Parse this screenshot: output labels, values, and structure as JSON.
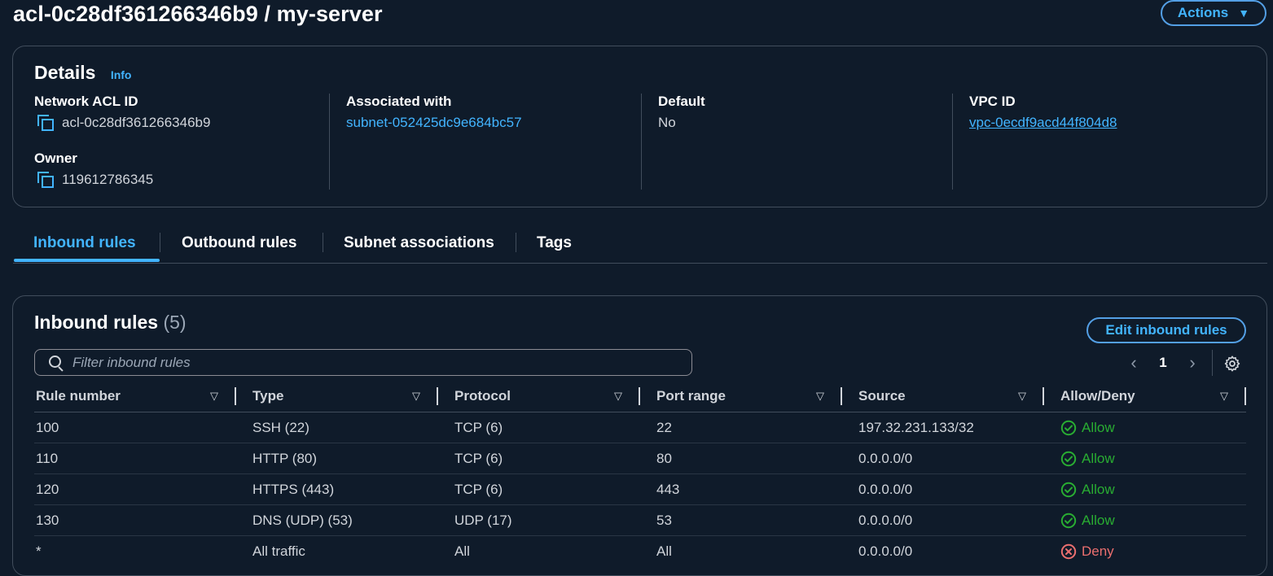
{
  "page": {
    "title": "acl-0c28df361266346b9 / my-server",
    "actions_label": "Actions"
  },
  "details": {
    "heading": "Details",
    "info_label": "Info",
    "network_acl_id_label": "Network ACL ID",
    "network_acl_id_value": "acl-0c28df361266346b9",
    "owner_label": "Owner",
    "owner_value": "119612786345",
    "associated_with_label": "Associated with",
    "associated_with_value": "subnet-052425dc9e684bc57",
    "default_label": "Default",
    "default_value": "No",
    "vpc_id_label": "VPC ID",
    "vpc_id_value": "vpc-0ecdf9acd44f804d8"
  },
  "tabs": [
    {
      "label": "Inbound rules",
      "active": true
    },
    {
      "label": "Outbound rules",
      "active": false
    },
    {
      "label": "Subnet associations",
      "active": false
    },
    {
      "label": "Tags",
      "active": false
    }
  ],
  "inbound": {
    "heading": "Inbound rules",
    "count": "(5)",
    "edit_button": "Edit inbound rules",
    "filter_placeholder": "Filter inbound rules",
    "page_number": "1",
    "columns": [
      "Rule number",
      "Type",
      "Protocol",
      "Port range",
      "Source",
      "Allow/Deny"
    ],
    "rows": [
      {
        "rule": "100",
        "type": "SSH (22)",
        "protocol": "TCP (6)",
        "port": "22",
        "source": "197.32.231.133/32",
        "action": "Allow"
      },
      {
        "rule": "110",
        "type": "HTTP (80)",
        "protocol": "TCP (6)",
        "port": "80",
        "source": "0.0.0.0/0",
        "action": "Allow"
      },
      {
        "rule": "120",
        "type": "HTTPS (443)",
        "protocol": "TCP (6)",
        "port": "443",
        "source": "0.0.0.0/0",
        "action": "Allow"
      },
      {
        "rule": "130",
        "type": "DNS (UDP) (53)",
        "protocol": "UDP (17)",
        "port": "53",
        "source": "0.0.0.0/0",
        "action": "Allow"
      },
      {
        "rule": "*",
        "type": "All traffic",
        "protocol": "All",
        "port": "All",
        "source": "0.0.0.0/0",
        "action": "Deny"
      }
    ]
  },
  "colors": {
    "background": "#0f1b2a",
    "link": "#42b4ff",
    "border": "#414d5c",
    "allow": "#29ad32",
    "deny": "#eb6f6f"
  },
  "icons": [
    "copy-icon",
    "search-icon",
    "gear-icon",
    "chevron-left-icon",
    "chevron-right-icon",
    "caret-down-icon",
    "sort-icon",
    "check-circle-icon",
    "x-circle-icon"
  ]
}
